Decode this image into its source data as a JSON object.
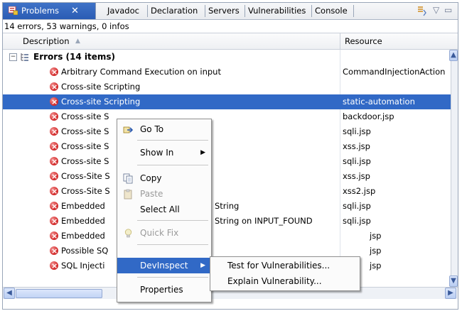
{
  "tabs": {
    "active": "Problems",
    "close": "✕",
    "others": [
      "Javadoc",
      "Declaration",
      "Servers",
      "Vulnerabilities",
      "Console"
    ]
  },
  "status": "14 errors, 53 warnings, 0 infos",
  "columns": {
    "description": "Description",
    "resource": "Resource"
  },
  "group": {
    "label": "Errors (14 items)"
  },
  "rows": [
    {
      "desc": "Arbitrary Command Execution on input",
      "res": "CommandInjectionAction"
    },
    {
      "desc": "Cross-site Scripting",
      "res": ""
    },
    {
      "desc": "Cross-site Scripting",
      "res": "static-automation"
    },
    {
      "desc": "Cross-site S",
      "res": "backdoor.jsp"
    },
    {
      "desc": "Cross-site S",
      "res": "sqli.jsp"
    },
    {
      "desc": "Cross-site S",
      "res": "xss.jsp"
    },
    {
      "desc": "Cross-site S",
      "res": "sqli.jsp"
    },
    {
      "desc": "Cross-Site S",
      "res": "xss.jsp"
    },
    {
      "desc": "Cross-Site S",
      "res": "xss2.jsp"
    },
    {
      "desc": "Embedded",
      "desc2": "String",
      "res": "sqli.jsp"
    },
    {
      "desc": "Embedded",
      "desc2": "String on INPUT_FOUND",
      "res": "sqli.jsp"
    },
    {
      "desc": "Embedded",
      "res": "jsp"
    },
    {
      "desc": "Possible SQ",
      "res": "jsp"
    },
    {
      "desc": "SQL Injecti",
      "res": "jsp"
    }
  ],
  "context_menu": {
    "go_to": "Go To",
    "show_in": "Show In",
    "copy": "Copy",
    "paste": "Paste",
    "select_all": "Select All",
    "quick_fix": "Quick Fix",
    "devinspect": "DevInspect",
    "properties": "Properties"
  },
  "submenu": {
    "test": "Test for Vulnerabilities...",
    "explain": "Explain Vulnerability..."
  },
  "colors": {
    "selection": "#3169c6",
    "active_tab": "#2a5cb4",
    "error_red": "#d73030"
  }
}
